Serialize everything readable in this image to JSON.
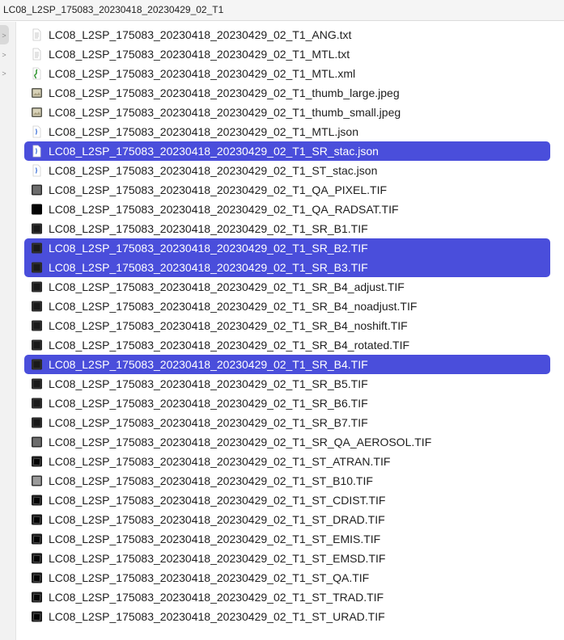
{
  "window": {
    "title": "LC08_L2SP_175083_20230418_20230429_02_T1"
  },
  "sidebar": {
    "chevrons": [
      ">",
      ">",
      ">"
    ]
  },
  "files": [
    {
      "name": "LC08_L2SP_175083_20230418_20230429_02_T1_ANG.txt",
      "icon": "text-document-icon",
      "kind": "text",
      "selected": false
    },
    {
      "name": "LC08_L2SP_175083_20230418_20230429_02_T1_MTL.txt",
      "icon": "text-document-icon",
      "kind": "text",
      "selected": false
    },
    {
      "name": "LC08_L2SP_175083_20230418_20230429_02_T1_MTL.xml",
      "icon": "xml-document-icon",
      "kind": "xml",
      "selected": false
    },
    {
      "name": "LC08_L2SP_175083_20230418_20230429_02_T1_thumb_large.jpeg",
      "icon": "image-thumbnail-icon",
      "kind": "jpeg",
      "selected": false
    },
    {
      "name": "LC08_L2SP_175083_20230418_20230429_02_T1_thumb_small.jpeg",
      "icon": "image-thumbnail-icon",
      "kind": "jpeg",
      "selected": false
    },
    {
      "name": "LC08_L2SP_175083_20230418_20230429_02_T1_MTL.json",
      "icon": "json-document-icon",
      "kind": "json",
      "selected": false
    },
    {
      "name": "LC08_L2SP_175083_20230418_20230429_02_T1_SR_stac.json",
      "icon": "json-document-icon",
      "kind": "json",
      "selected": true
    },
    {
      "name": "LC08_L2SP_175083_20230418_20230429_02_T1_ST_stac.json",
      "icon": "json-document-icon",
      "kind": "json",
      "selected": false
    },
    {
      "name": "LC08_L2SP_175083_20230418_20230429_02_T1_QA_PIXEL.TIF",
      "icon": "tif-image-icon",
      "kind": "tif-gray",
      "selected": false
    },
    {
      "name": "LC08_L2SP_175083_20230418_20230429_02_T1_QA_RADSAT.TIF",
      "icon": "tif-image-icon",
      "kind": "tif-black",
      "selected": false
    },
    {
      "name": "LC08_L2SP_175083_20230418_20230429_02_T1_SR_B1.TIF",
      "icon": "tif-image-icon",
      "kind": "tif-dark",
      "selected": false
    },
    {
      "name": "LC08_L2SP_175083_20230418_20230429_02_T1_SR_B2.TIF",
      "icon": "tif-image-icon",
      "kind": "tif-dark",
      "selected": true
    },
    {
      "name": "LC08_L2SP_175083_20230418_20230429_02_T1_SR_B3.TIF",
      "icon": "tif-image-icon",
      "kind": "tif-dark",
      "selected": true
    },
    {
      "name": "LC08_L2SP_175083_20230418_20230429_02_T1_SR_B4_adjust.TIF",
      "icon": "tif-image-icon",
      "kind": "tif-dark",
      "selected": false
    },
    {
      "name": "LC08_L2SP_175083_20230418_20230429_02_T1_SR_B4_noadjust.TIF",
      "icon": "tif-image-icon",
      "kind": "tif-dark",
      "selected": false
    },
    {
      "name": "LC08_L2SP_175083_20230418_20230429_02_T1_SR_B4_noshift.TIF",
      "icon": "tif-image-icon",
      "kind": "tif-dark",
      "selected": false
    },
    {
      "name": "LC08_L2SP_175083_20230418_20230429_02_T1_SR_B4_rotated.TIF",
      "icon": "tif-image-icon",
      "kind": "tif-dark",
      "selected": false
    },
    {
      "name": "LC08_L2SP_175083_20230418_20230429_02_T1_SR_B4.TIF",
      "icon": "tif-image-icon",
      "kind": "tif-dark",
      "selected": true
    },
    {
      "name": "LC08_L2SP_175083_20230418_20230429_02_T1_SR_B5.TIF",
      "icon": "tif-image-icon",
      "kind": "tif-dark",
      "selected": false
    },
    {
      "name": "LC08_L2SP_175083_20230418_20230429_02_T1_SR_B6.TIF",
      "icon": "tif-image-icon",
      "kind": "tif-dark",
      "selected": false
    },
    {
      "name": "LC08_L2SP_175083_20230418_20230429_02_T1_SR_B7.TIF",
      "icon": "tif-image-icon",
      "kind": "tif-dark",
      "selected": false
    },
    {
      "name": "LC08_L2SP_175083_20230418_20230429_02_T1_SR_QA_AEROSOL.TIF",
      "icon": "tif-image-icon",
      "kind": "tif-gray",
      "selected": false
    },
    {
      "name": "LC08_L2SP_175083_20230418_20230429_02_T1_ST_ATRAN.TIF",
      "icon": "tif-image-icon",
      "kind": "tif-tilt",
      "selected": false
    },
    {
      "name": "LC08_L2SP_175083_20230418_20230429_02_T1_ST_B10.TIF",
      "icon": "tif-image-icon",
      "kind": "tif-light",
      "selected": false
    },
    {
      "name": "LC08_L2SP_175083_20230418_20230429_02_T1_ST_CDIST.TIF",
      "icon": "tif-image-icon",
      "kind": "tif-tilt",
      "selected": false
    },
    {
      "name": "LC08_L2SP_175083_20230418_20230429_02_T1_ST_DRAD.TIF",
      "icon": "tif-image-icon",
      "kind": "tif-tilt",
      "selected": false
    },
    {
      "name": "LC08_L2SP_175083_20230418_20230429_02_T1_ST_EMIS.TIF",
      "icon": "tif-image-icon",
      "kind": "tif-tilt",
      "selected": false
    },
    {
      "name": "LC08_L2SP_175083_20230418_20230429_02_T1_ST_EMSD.TIF",
      "icon": "tif-image-icon",
      "kind": "tif-tilt",
      "selected": false
    },
    {
      "name": "LC08_L2SP_175083_20230418_20230429_02_T1_ST_QA.TIF",
      "icon": "tif-image-icon",
      "kind": "tif-tilt",
      "selected": false
    },
    {
      "name": "LC08_L2SP_175083_20230418_20230429_02_T1_ST_TRAD.TIF",
      "icon": "tif-image-icon",
      "kind": "tif-tilt",
      "selected": false
    },
    {
      "name": "LC08_L2SP_175083_20230418_20230429_02_T1_ST_URAD.TIF",
      "icon": "tif-image-icon",
      "kind": "tif-tilt",
      "selected": false
    }
  ],
  "colors": {
    "selection": "#4a4edb",
    "text": "#1e1e1e",
    "selected_text": "#ffffff"
  }
}
